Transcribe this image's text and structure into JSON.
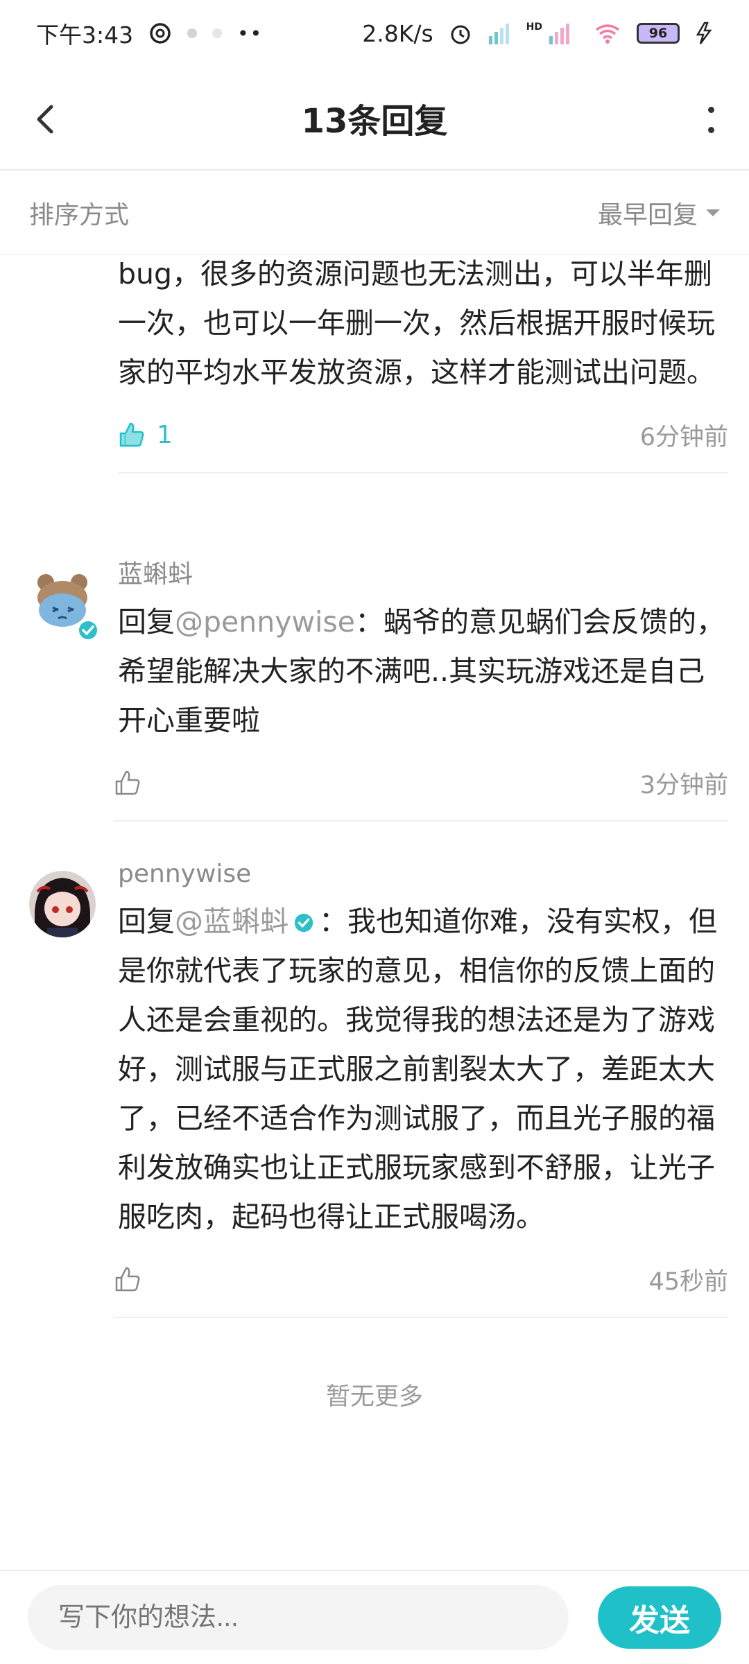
{
  "status_bar": {
    "time": "下午3:43",
    "net_speed": "2.8K/s",
    "signal_hd": "HD",
    "battery": "96"
  },
  "header": {
    "title": "13条回复"
  },
  "sort": {
    "label": "排序方式",
    "selected": "最早回复"
  },
  "comments": [
    {
      "text": "bug，很多的资源问题也无法测出，可以半年删一次，也可以一年删一次，然后根据开服时候玩家的平均水平发放资源，这样才能测试出问题。",
      "likes": "1",
      "time": "6分钟前"
    },
    {
      "username": "蓝蝌蚪",
      "reply_prefix": "回复",
      "mention": "@pennywise",
      "text": "：蜗爷的意见蜗们会反馈的，希望能解决大家的不满吧..其实玩游戏还是自己开心重要啦",
      "time": "3分钟前"
    },
    {
      "username": "pennywise",
      "reply_prefix": "回复",
      "mention": "@蓝蝌蚪",
      "text": "：我也知道你难，没有实权，但是你就代表了玩家的意见，相信你的反馈上面的人还是会重视的。我觉得我的想法还是为了游戏好，测试服与正式服之前割裂太大了，差距太大了，已经不适合作为测试服了，而且光子服的福利发放确实也让正式服玩家感到不舒服，让光子服吃肉，起码也得让正式服喝汤。",
      "time": "45秒前"
    }
  ],
  "footer": {
    "no_more": "暂无更多"
  },
  "composer": {
    "placeholder": "写下你的想法...",
    "send_label": "发送"
  },
  "colors": {
    "accent": "#1fc0c8",
    "muted": "#9a9a9a"
  }
}
